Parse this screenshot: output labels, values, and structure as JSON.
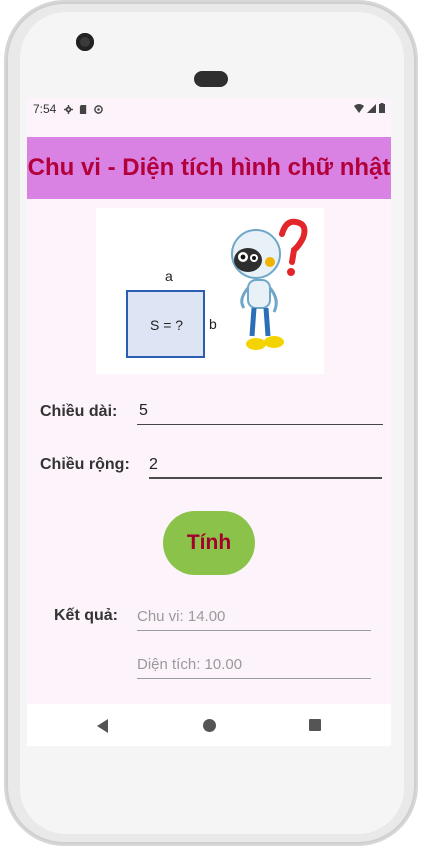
{
  "status_bar": {
    "time": "7:54"
  },
  "app": {
    "title": "Chu vi - Diện tích hình chữ nhật"
  },
  "illustration": {
    "label_a": "a",
    "label_b": "b",
    "formula": "S = ?"
  },
  "form": {
    "length_label": "Chiều dài:",
    "length_value": "5",
    "width_label": "Chiều rộng:",
    "width_value": "2",
    "calc_button": "Tính",
    "result_label": "Kết quả:",
    "perimeter_text": "Chu vi: 14.00",
    "area_text": "Diện tích: 10.00"
  },
  "colors": {
    "title_bar": "#da82e4",
    "title_text": "#b1003a",
    "button_bg": "#8bc34a",
    "button_text": "#a4002c",
    "screen_bg": "#fcf3fb"
  },
  "icons": [
    "gear-icon",
    "sd-card-icon",
    "sync-icon",
    "wifi-icon",
    "signal-icon",
    "battery-icon",
    "back-icon",
    "home-icon",
    "recents-icon"
  ]
}
